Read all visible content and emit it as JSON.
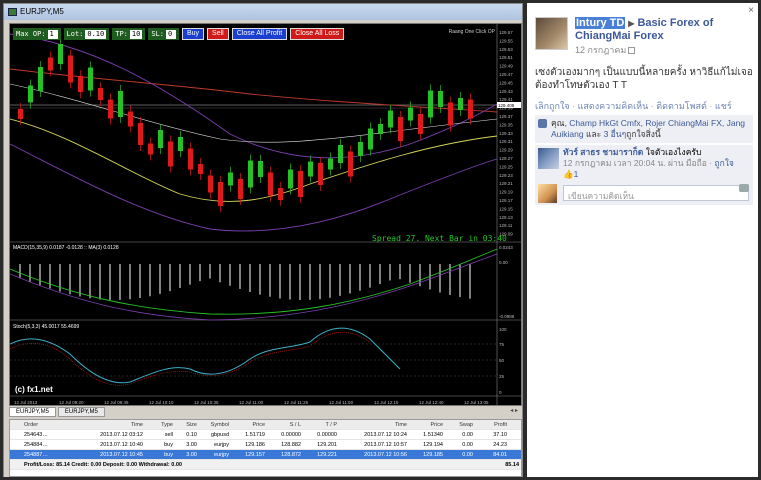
{
  "window": {
    "title": "EURJPY,M5"
  },
  "toolbar": {
    "maxop_label": "Max OP:",
    "maxop_value": "1",
    "lot_label": "Lot:",
    "lot_value": "0.10",
    "tp_label": "TP:",
    "tp_value": "10",
    "sl_label": "SL:",
    "sl_value": "0",
    "buy": "Buy",
    "sell": "Sell",
    "close_profit": "Close All Profit",
    "close_loss": "Close All Loss"
  },
  "chart_overlay": {
    "oneclick": "Raang One Click OP",
    "spread": "Spread 27. Next Bar in 03:40",
    "macd_label": "MACD(15,35,9) 0.0187 -0.0128 :: MA(3) 0.0128",
    "stoch_label": "Stoch(5,3,3) 45.0017 55.4699",
    "watermark": "(c) fx1.net"
  },
  "chart_data": [
    {
      "type": "candlestick",
      "price_axis": [
        "129.57",
        "129.55",
        "129.53",
        "129.51",
        "129.49",
        "129.47",
        "129.45",
        "129.43",
        "129.41",
        "129.39",
        "129.37",
        "129.35",
        "129.33",
        "129.31",
        "129.29",
        "129.27",
        "129.25",
        "129.23",
        "129.21",
        "129.19",
        "129.17",
        "129.15",
        "129.13",
        "129.11",
        "129.09"
      ],
      "candles_dir": [
        "d",
        "u",
        "u",
        "d",
        "u",
        "d",
        "d",
        "u",
        "d",
        "d",
        "u",
        "d",
        "d",
        "d",
        "u",
        "d",
        "u",
        "d",
        "d",
        "d",
        "d",
        "u",
        "d",
        "u",
        "u",
        "d",
        "d",
        "u",
        "d",
        "u",
        "d",
        "u",
        "u",
        "d",
        "u",
        "u",
        "u",
        "u",
        "d",
        "u",
        "d",
        "u",
        "u",
        "d",
        "u",
        "d"
      ],
      "current_price_label": "129.405"
    },
    {
      "type": "bar",
      "name": "MACD",
      "ylim": [
        -0.0986,
        0.0243
      ],
      "axis": [
        "0.0243",
        "0.00",
        "-0.0986"
      ]
    },
    {
      "type": "line",
      "name": "Stoch",
      "ylim": [
        0,
        100
      ],
      "axis": [
        "100",
        "75",
        "50",
        "25",
        "0"
      ]
    }
  ],
  "time_axis": [
    "12 Jul 2013",
    "12 Jul 09:20",
    "12 Jul 09:45",
    "12 Jul 10:10",
    "12 Jul 10:35",
    "12 Jul 11:00",
    "12 Jul 11:25",
    "12 Jul 11:50",
    "12 Jul 12:15",
    "12 Jul 12:40",
    "12 Jul 13:05"
  ],
  "tabs": [
    {
      "label": "EURJPY,M5",
      "active": true
    },
    {
      "label": "EURJPY,M5",
      "active": false
    }
  ],
  "terminal": {
    "headers": [
      "Order",
      "Time",
      "Type",
      "Size",
      "Symbol",
      "Price",
      "S / L",
      "T / P",
      "Time",
      "Price",
      "Swap",
      "Profit"
    ],
    "rows": [
      [
        "254643…",
        "2013.07.12 03:12",
        "sell",
        "0.10",
        "gbpusd",
        "1.51719",
        "0.00000",
        "0.00000",
        "2013.07.12 10:24",
        "1.51340",
        "0.00",
        "37.10"
      ],
      [
        "254884…",
        "2013.07.12 10:40",
        "buy",
        "3.00",
        "eurjpy",
        "129.186",
        "128.882",
        "129.201",
        "2013.07.12 10:57",
        "129.194",
        "0.00",
        "24.23"
      ],
      [
        "254887…",
        "2013.07.12 10:45",
        "buy",
        "3.00",
        "eurjpy",
        "129.157",
        "128.872",
        "129.221",
        "2013.07.12 10:56",
        "129.185",
        "0.00",
        "84.01"
      ]
    ],
    "footer": "Profit/Loss: 85.14  Credit: 0.00  Deposit: 0.00  Withdrawal: 0.00",
    "footer_total": "85.14"
  },
  "facebook": {
    "close": "×",
    "author": "Intury TD",
    "group": "Basic Forex of ChiangMai Forex",
    "date": "12 กรกฎาคม",
    "post": "เซงตัวเองมากๆ เป็นแบบนี้หลายครั้ง หาวิธีแก้ไม่เจอ ต้องทำโทษตัวเอง T T",
    "actions": [
      "เลิกถูกใจ",
      "แสดงความคิดเห็น",
      "ติดตามโพสต์",
      "แชร์"
    ],
    "likes_prefix": "คุณ, ",
    "likes_names": "Champ HkGt Cmfx, Rojer ChiangMai FX, Jang Auikiang",
    "likes_suffix": " และ ",
    "likes_more": "3 อื่นๆ",
    "likes_end": "ถูกใจสิ่งนี้",
    "comment_name": "ทัวร์ สาธร ชามาราก็ด",
    "comment_text": "ใจตัวเองไงครับ",
    "comment_meta": "12 กรกฎาคม เวลา 20:04 น. ผ่าน มือถือ · ",
    "comment_like_link": "ถูกใจ",
    "comment_likes": "1",
    "write_placeholder": "เขียนความคิดเห็น"
  }
}
